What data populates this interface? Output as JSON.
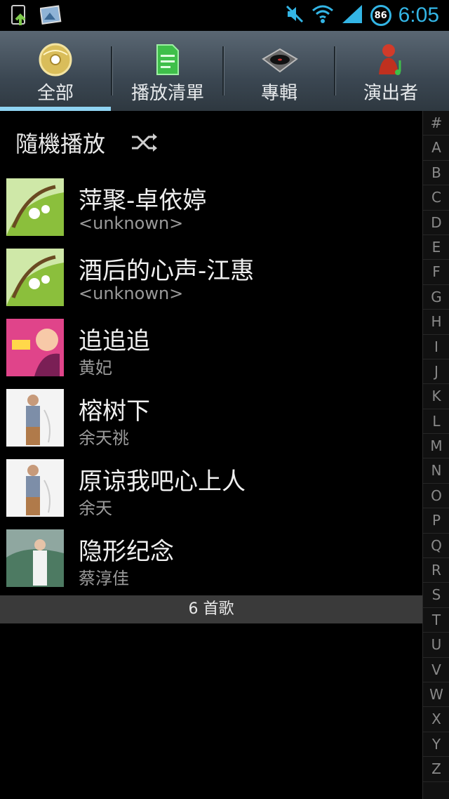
{
  "status_bar": {
    "time": "6:05",
    "battery": "86"
  },
  "tabs": [
    {
      "label": "全部",
      "icon": "all-songs-icon",
      "selected": true
    },
    {
      "label": "播放清單",
      "icon": "playlist-icon",
      "selected": false
    },
    {
      "label": "專輯",
      "icon": "album-turntable-icon",
      "selected": false
    },
    {
      "label": "演出者",
      "icon": "artist-icon",
      "selected": false
    }
  ],
  "shuffle": {
    "label": "隨機播放"
  },
  "songs": [
    {
      "title": "萍聚-卓依婷",
      "artist": "<unknown>",
      "art": "green-leaves"
    },
    {
      "title": "酒后的心声-江惠",
      "artist": "<unknown>",
      "art": "green-leaves"
    },
    {
      "title": "追追追",
      "artist": "黄妃",
      "art": "pink-portrait"
    },
    {
      "title": "榕树下",
      "artist": "余天祧",
      "art": "man-white"
    },
    {
      "title": "原谅我吧心上人",
      "artist": "余天",
      "art": "man-white"
    },
    {
      "title": "隐形纪念",
      "artist": "蔡淳佳",
      "art": "woman-sky"
    }
  ],
  "footer": {
    "count_label": "6 首歌"
  },
  "alphabet": [
    "#",
    "A",
    "B",
    "C",
    "D",
    "E",
    "F",
    "G",
    "H",
    "I",
    "J",
    "K",
    "L",
    "M",
    "N",
    "O",
    "P",
    "Q",
    "R",
    "S",
    "T",
    "U",
    "V",
    "W",
    "X",
    "Y",
    "Z"
  ],
  "colors": {
    "accent": "#33b5e5",
    "tab_indicator": "#8fd3f2"
  }
}
